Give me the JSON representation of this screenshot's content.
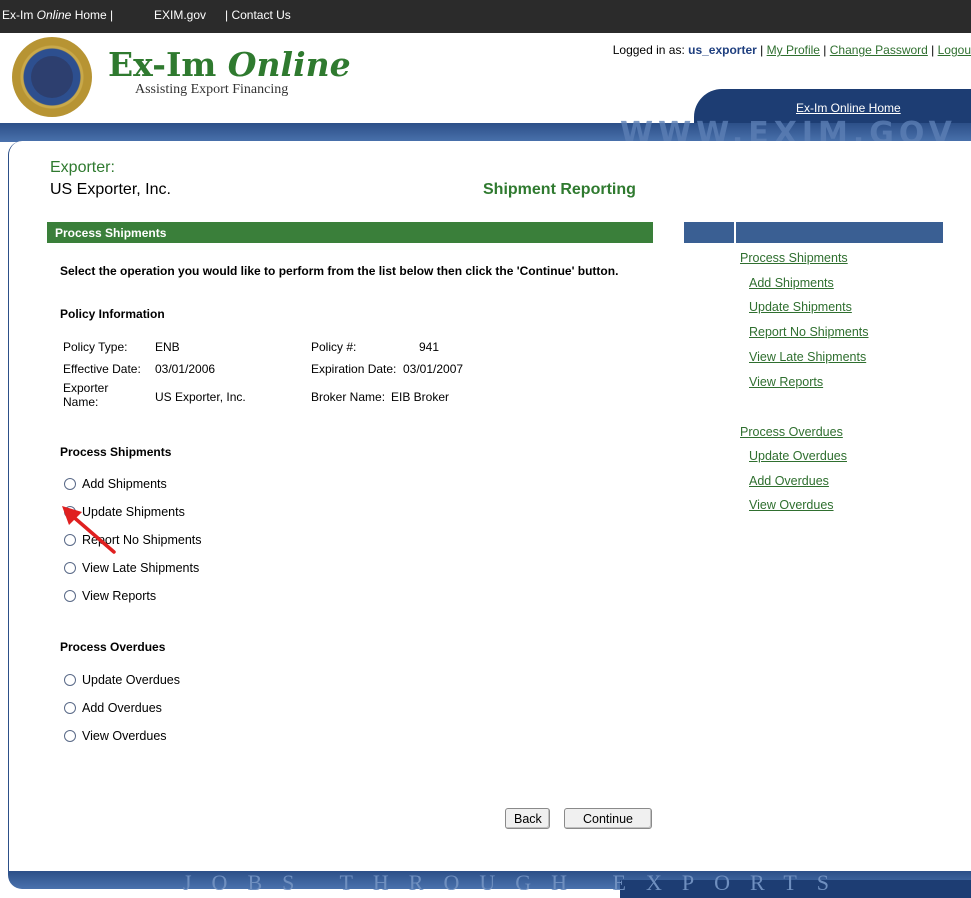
{
  "topnav": {
    "home_prefix": "Ex-Im ",
    "home_online": "Online",
    "home_suffix": " Home |",
    "eximgov": "EXIM.gov",
    "contact": "| Contact Us"
  },
  "header": {
    "logo_main": "Ex-Im ",
    "logo_italic": "Online",
    "logo_sub": "Assisting Export Financing",
    "login_label": "Logged in as: ",
    "login_user": "us_exporter",
    "sep": " | ",
    "profile_link": "My Profile",
    "password_link": "Change Password",
    "logout_link": "Logou",
    "home_tab": "Ex-Im Online Home",
    "watermark": "WWW.EXIM.GOV"
  },
  "page": {
    "exporter_label": "Exporter:",
    "exporter_name": "US Exporter, Inc.",
    "heading": "Shipment Reporting",
    "section_title": "Process Shipments",
    "instructions": "Select the operation you would like to perform from the list below then click the 'Continue' button."
  },
  "policy": {
    "heading": "Policy Information",
    "type_label": "Policy Type:",
    "type_value": "ENB",
    "number_label": "Policy #:",
    "number_value": "941",
    "effective_label": "Effective Date:",
    "effective_value": "03/01/2006",
    "expiration_label": "Expiration Date:",
    "expiration_value": "03/01/2007",
    "exporter_label_1": "Exporter",
    "exporter_label_2": "Name:",
    "exporter_value": "US Exporter, Inc.",
    "broker_label": "Broker Name:",
    "broker_value": "EIB Broker"
  },
  "shipments": {
    "heading": "Process Shipments",
    "options": [
      "Add Shipments",
      "Update Shipments",
      "Report No Shipments",
      "View Late Shipments",
      "View Reports"
    ],
    "selected": "Update Shipments"
  },
  "overdues": {
    "heading": "Process Overdues",
    "options": [
      "Update Overdues",
      "Add Overdues",
      "View Overdues"
    ]
  },
  "buttons": {
    "back": "Back",
    "continue": "Continue"
  },
  "sidebar": {
    "shipments_heading": "Process Shipments",
    "shipments_links": [
      "Add Shipments",
      "Update Shipments",
      "Report No Shipments",
      "View Late Shipments",
      "View Reports"
    ],
    "overdues_heading": "Process Overdues",
    "overdues_links": [
      "Update Overdues",
      "Add Overdues",
      "View Overdues"
    ]
  },
  "footer": {
    "tagline": "JOBS THROUGH EXPORTS"
  },
  "colors": {
    "brand_green": "#2f7a2f",
    "brand_blue": "#1d3d73",
    "annotation_arrow": "#e02020"
  }
}
